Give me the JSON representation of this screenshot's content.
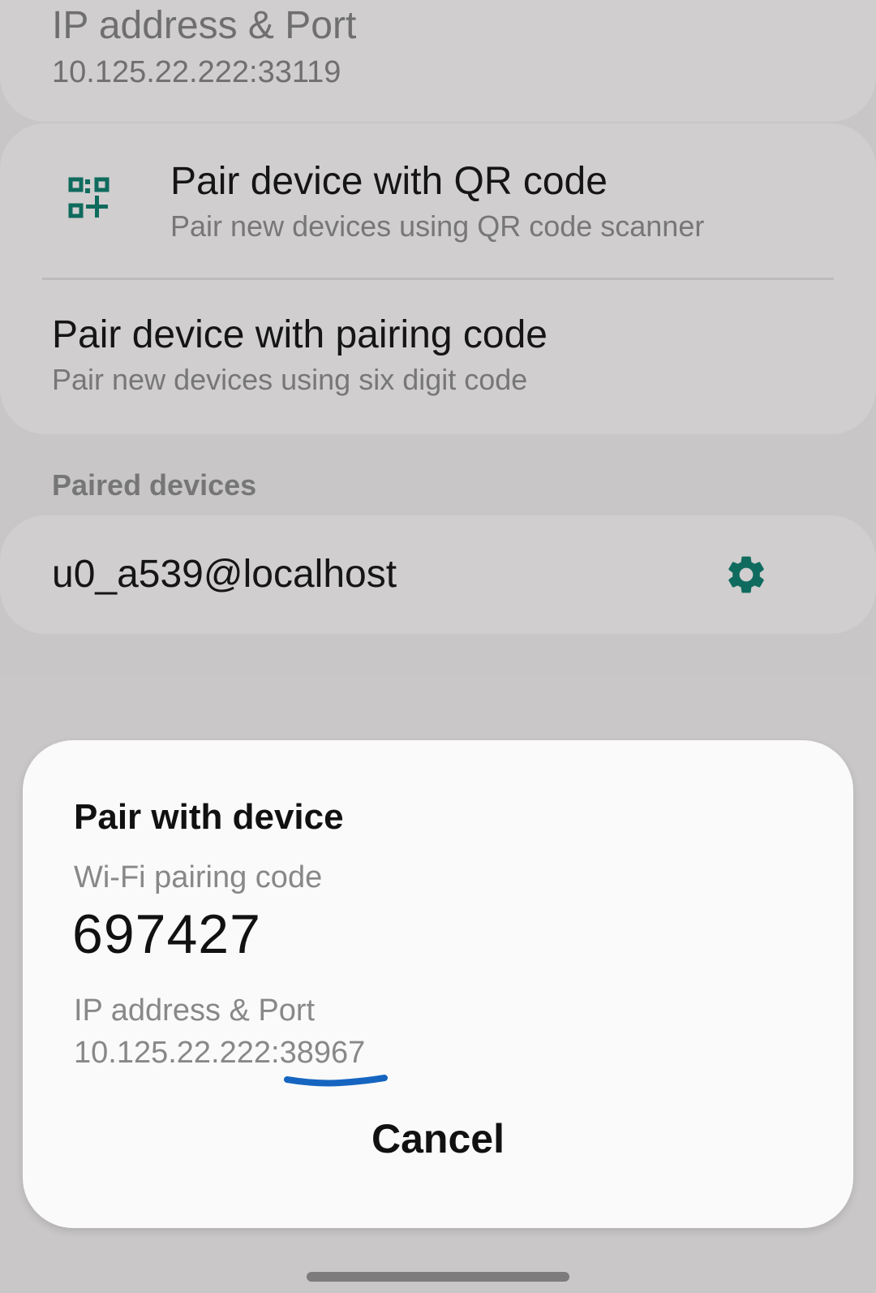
{
  "top_item": {
    "title": "IP address & Port",
    "value": "10.125.22.222:33119"
  },
  "pair_options": [
    {
      "title": "Pair device with QR code",
      "subtitle": "Pair new devices using QR code scanner",
      "icon": "qr-code-add-icon"
    },
    {
      "title": "Pair device with pairing code",
      "subtitle": "Pair new devices using six digit code"
    }
  ],
  "paired_devices": {
    "label": "Paired devices",
    "items": [
      {
        "name": "u0_a539@localhost",
        "icon": "gear-icon"
      }
    ]
  },
  "dialog": {
    "title": "Pair with device",
    "code_label": "Wi-Fi pairing code",
    "code": "697427",
    "address_label": "IP address & Port",
    "address": "10.125.22.222:38967",
    "cancel_label": "Cancel"
  },
  "colors": {
    "accent": "#0f6b5e",
    "annotation": "#1565c0"
  }
}
